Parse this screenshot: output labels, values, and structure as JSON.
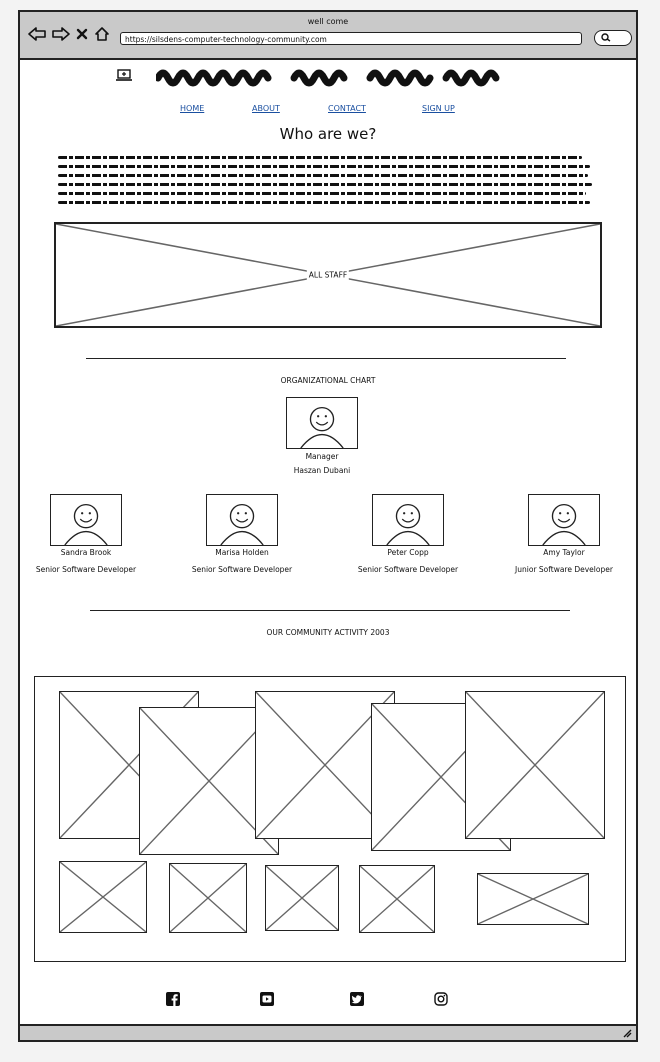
{
  "window": {
    "title": "well come",
    "url": "https://silsdens-computer-technology-community.com"
  },
  "logo": {
    "icon": "laptop-icon"
  },
  "nav": [
    {
      "label": "HOME"
    },
    {
      "label": "ABOUT"
    },
    {
      "label": "CONTACT"
    },
    {
      "label": "SIGN UP"
    }
  ],
  "about": {
    "heading": "Who are we?"
  },
  "staff_image": {
    "label": "ALL STAFF"
  },
  "org_chart": {
    "title": "ORGANIZATIONAL CHART",
    "manager": {
      "role": "Manager",
      "name": "Haszan Dubani"
    },
    "members": [
      {
        "name": "Sandra Brook",
        "role": "Senior Software Developer"
      },
      {
        "name": "Marisa Holden",
        "role": "Senior Software Developer"
      },
      {
        "name": "Peter Copp",
        "role": "Senior Software Developer"
      },
      {
        "name": "Amy Taylor",
        "role": "Junior Software Developer"
      }
    ]
  },
  "community": {
    "title": "OUR COMMUNITY ACTIVITY 2003"
  },
  "footer": {
    "icons": [
      "facebook-icon",
      "youtube-icon",
      "twitter-icon",
      "instagram-icon"
    ]
  }
}
